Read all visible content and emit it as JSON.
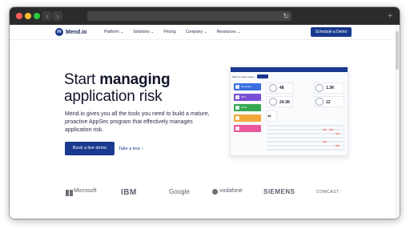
{
  "browser": {
    "back_icon": "chevron-left-icon",
    "forward_icon": "chevron-right-icon",
    "reload_icon": "reload-icon",
    "new_tab_icon": "plus-icon"
  },
  "header": {
    "logo_text": "Mend.io",
    "nav": [
      "Platform",
      "Solutions",
      "Pricing",
      "Company",
      "Resources"
    ],
    "cta": "Schedule a Demo"
  },
  "hero": {
    "title_plain_1": "Start ",
    "title_bold": "managing",
    "title_plain_2": "application risk",
    "description": "Mend.io gives you all the tools you need to build a mature, proactive AppSec program that effectively manages application risk.",
    "primary_button": "Book a live demo",
    "secondary_link": "Take a tour ›"
  },
  "dashboard": {
    "filter_label": "Filter by scan engine",
    "engines": [
      {
        "label": "Renovate",
        "color": "#3b6fe0"
      },
      {
        "label": "SCA",
        "color": "#7a4fd6"
      },
      {
        "label": "SAST",
        "color": "#36a852"
      },
      {
        "label": "",
        "color": "#f2a93b"
      },
      {
        "label": "",
        "color": "#e8589a"
      }
    ],
    "stats": [
      "48",
      "1.3K",
      "24.3K",
      "12"
    ],
    "small_stat": "48"
  },
  "logos": [
    "Microsoft",
    "IBM",
    "Google",
    "vodafone",
    "SIEMENS",
    "COMCAST"
  ],
  "colors": {
    "brand": "#1a3a8f",
    "text": "#13162b"
  }
}
